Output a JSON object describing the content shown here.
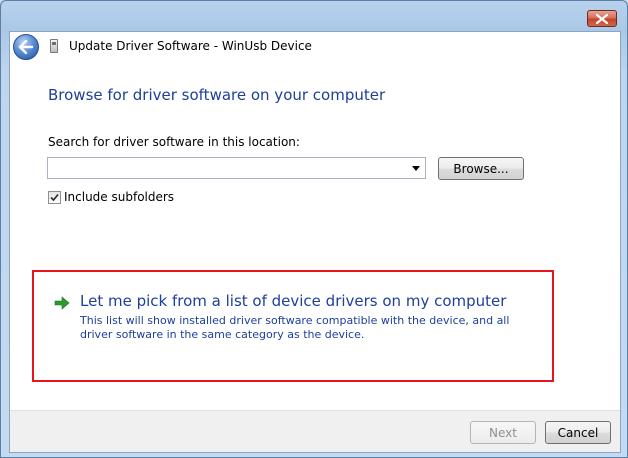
{
  "window": {
    "title": "Update Driver Software - WinUsb Device"
  },
  "page": {
    "heading": "Browse for driver software on your computer",
    "search_label": "Search for driver software in this location:",
    "path_value": "",
    "browse_label": "Browse...",
    "include_subfolders_label": "Include subfolders",
    "include_subfolders_checked": true
  },
  "option": {
    "title": "Let me pick from a list of device drivers on my computer",
    "description": "This list will show installed driver software compatible with the device, and all driver software in the same category as the device."
  },
  "footer": {
    "next_label": "Next",
    "cancel_label": "Cancel"
  },
  "colors": {
    "heading_blue": "#1e3f9a",
    "highlight_red": "#e8141c",
    "arrow_green": "#2e9a2e"
  },
  "icons": {
    "back": "back-arrow-icon",
    "device": "usb-device-icon",
    "close": "close-icon",
    "dropdown": "chevron-down-icon",
    "option_arrow": "green-arrow-icon",
    "checkbox": "checkmark-icon"
  }
}
